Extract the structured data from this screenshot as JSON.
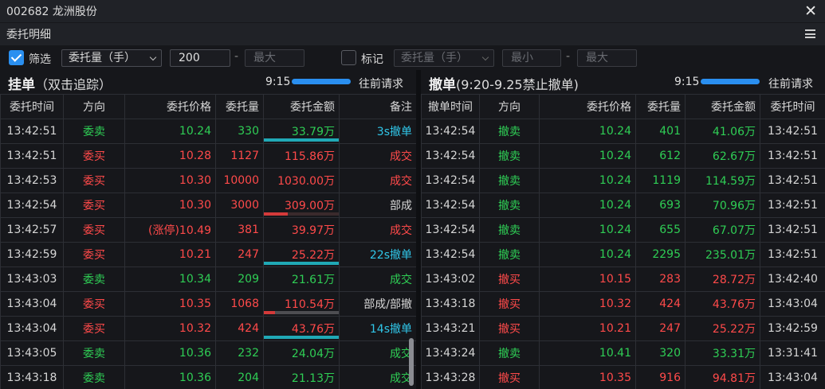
{
  "window": {
    "title": "002682 龙洲股份",
    "close_icon": "close-icon"
  },
  "subbar": {
    "title": "委托明细",
    "menu_icon": "hamburger-menu-icon"
  },
  "filter": {
    "filter_checked": true,
    "filter_label": "筛选",
    "field1": "委托量（手）",
    "min1": "200",
    "max1_placeholder": "最大",
    "mark_checked": false,
    "mark_label": "标记",
    "field2": "委托量（手）",
    "min2_placeholder": "最小",
    "max2_placeholder": "最大",
    "dash": "-"
  },
  "pending": {
    "title": "挂单",
    "subtitle": "（双击追踪）",
    "time": "9:15",
    "request": "往前请求",
    "headers": [
      "委托时间",
      "方向",
      "委托价格",
      "委托量",
      "委托金额",
      "备注"
    ],
    "rows": [
      {
        "time": "13:42:51",
        "dir": "委卖",
        "price": "10.24",
        "qty": "330",
        "amount": "33.79万",
        "note": "3s撤单",
        "color": "green",
        "note_color": "cyan",
        "bar": "cancel",
        "bar_pct": 1.0
      },
      {
        "time": "13:42:51",
        "dir": "委买",
        "price": "10.28",
        "qty": "1127",
        "amount": "115.86万",
        "note": "成交",
        "color": "red",
        "note_color": "red",
        "bar": "none",
        "bar_pct": 0
      },
      {
        "time": "13:42:53",
        "dir": "委买",
        "price": "10.30",
        "qty": "10000",
        "amount": "1030.00万",
        "note": "成交",
        "color": "red",
        "note_color": "red",
        "bar": "none",
        "bar_pct": 0
      },
      {
        "time": "13:42:54",
        "dir": "委买",
        "price": "10.30",
        "qty": "3000",
        "amount": "309.00万",
        "note": "部成",
        "color": "red",
        "note_color": "white",
        "bar": "partial-dark",
        "bar_pct": 0.32
      },
      {
        "time": "13:42:57",
        "dir": "委买",
        "price": "(涨停)10.49",
        "qty": "381",
        "amount": "39.97万",
        "note": "成交",
        "color": "red",
        "note_color": "red",
        "bar": "none",
        "bar_pct": 0
      },
      {
        "time": "13:42:59",
        "dir": "委买",
        "price": "10.21",
        "qty": "247",
        "amount": "25.22万",
        "note": "22s撤单",
        "color": "red",
        "note_color": "cyan",
        "bar": "cancel",
        "bar_pct": 1.0
      },
      {
        "time": "13:43:03",
        "dir": "委卖",
        "price": "10.34",
        "qty": "209",
        "amount": "21.61万",
        "note": "成交",
        "color": "green",
        "note_color": "green",
        "bar": "none",
        "bar_pct": 0
      },
      {
        "time": "13:43:04",
        "dir": "委买",
        "price": "10.35",
        "qty": "1068",
        "amount": "110.54万",
        "note": "部成/部撤",
        "color": "red",
        "note_color": "white",
        "bar": "partial",
        "bar_pct": 0.15
      },
      {
        "time": "13:43:04",
        "dir": "委买",
        "price": "10.32",
        "qty": "424",
        "amount": "43.76万",
        "note": "14s撤单",
        "color": "red",
        "note_color": "cyan",
        "bar": "cancel",
        "bar_pct": 1.0
      },
      {
        "time": "13:43:05",
        "dir": "委卖",
        "price": "10.36",
        "qty": "232",
        "amount": "24.04万",
        "note": "成交",
        "color": "green",
        "note_color": "green",
        "bar": "none",
        "bar_pct": 0
      },
      {
        "time": "13:43:18",
        "dir": "委卖",
        "price": "10.36",
        "qty": "204",
        "amount": "21.13万",
        "note": "成交",
        "color": "green",
        "note_color": "green",
        "bar": "none",
        "bar_pct": 0
      }
    ]
  },
  "cancelled": {
    "title": "撤单",
    "subtitle": "(9:20-9.25禁止撤单)",
    "time": "9:15",
    "request": "往前请求",
    "headers": [
      "撤单时间",
      "方向",
      "委托价格",
      "委托量",
      "委托金额",
      "委托时间"
    ],
    "rows": [
      {
        "time": "13:42:54",
        "dir": "撤卖",
        "price": "10.24",
        "qty": "401",
        "amount": "41.06万",
        "order_time": "13:42:51",
        "color": "green"
      },
      {
        "time": "13:42:54",
        "dir": "撤卖",
        "price": "10.24",
        "qty": "612",
        "amount": "62.67万",
        "order_time": "13:42:51",
        "color": "green"
      },
      {
        "time": "13:42:54",
        "dir": "撤卖",
        "price": "10.24",
        "qty": "1119",
        "amount": "114.59万",
        "order_time": "13:42:51",
        "color": "green"
      },
      {
        "time": "13:42:54",
        "dir": "撤卖",
        "price": "10.24",
        "qty": "693",
        "amount": "70.96万",
        "order_time": "13:42:51",
        "color": "green"
      },
      {
        "time": "13:42:54",
        "dir": "撤卖",
        "price": "10.24",
        "qty": "655",
        "amount": "67.07万",
        "order_time": "13:42:51",
        "color": "green"
      },
      {
        "time": "13:42:54",
        "dir": "撤卖",
        "price": "10.24",
        "qty": "2295",
        "amount": "235.01万",
        "order_time": "13:42:51",
        "color": "green"
      },
      {
        "time": "13:43:02",
        "dir": "撤买",
        "price": "10.15",
        "qty": "283",
        "amount": "28.72万",
        "order_time": "13:42:40",
        "color": "red"
      },
      {
        "time": "13:43:18",
        "dir": "撤买",
        "price": "10.32",
        "qty": "424",
        "amount": "43.76万",
        "order_time": "13:43:04",
        "color": "red"
      },
      {
        "time": "13:43:21",
        "dir": "撤买",
        "price": "10.21",
        "qty": "247",
        "amount": "25.22万",
        "order_time": "13:42:59",
        "color": "red"
      },
      {
        "time": "13:43:24",
        "dir": "撤卖",
        "price": "10.41",
        "qty": "320",
        "amount": "33.31万",
        "order_time": "13:31:41",
        "color": "green"
      },
      {
        "time": "13:43:28",
        "dir": "撤买",
        "price": "10.35",
        "qty": "916",
        "amount": "94.81万",
        "order_time": "13:43:04",
        "color": "red"
      }
    ]
  },
  "colors": {
    "red": "#ff4a4a",
    "green": "#2fce55",
    "cyan": "#30c6e8",
    "accent": "#2a8ff0",
    "cancel_bar": "#20a9b6"
  }
}
